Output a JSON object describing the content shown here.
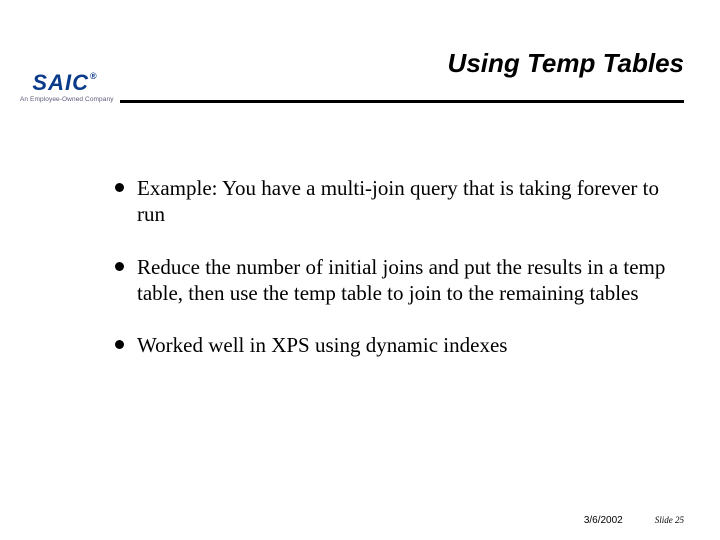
{
  "title": "Using Temp Tables",
  "logo": {
    "name": "SAIC",
    "reg": "®",
    "tagline": "An Employee-Owned Company"
  },
  "bullets": [
    "Example: You have a multi-join query that is taking forever to run",
    "Reduce the number of initial joins and put the results in a temp table, then use the temp table to join to the remaining tables",
    "Worked well in XPS using dynamic indexes"
  ],
  "footer": {
    "date": "3/6/2002",
    "slide_label": "Slide 25"
  }
}
